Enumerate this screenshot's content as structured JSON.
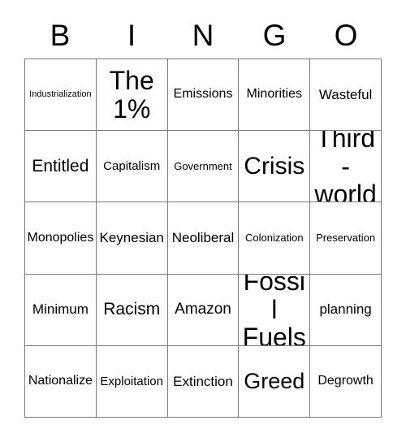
{
  "card": {
    "header_letters": [
      "B",
      "I",
      "N",
      "G",
      "O"
    ],
    "grid_size": 5,
    "colors": {
      "background": "#ffffff",
      "text": "#000000",
      "border": "#7a7a7a"
    },
    "rows": [
      [
        {
          "label": "Industrialization",
          "size": "fs-xxs"
        },
        {
          "label": "The 1%",
          "size": "fs-h2"
        },
        {
          "label": "Emissions",
          "size": "fs-m"
        },
        {
          "label": "Minorities",
          "size": "fs-m"
        },
        {
          "label": "Wasteful",
          "size": "fs-ml"
        }
      ],
      [
        {
          "label": "Entitled",
          "size": "fs-xl"
        },
        {
          "label": "Capitalism",
          "size": "fs-s"
        },
        {
          "label": "Government",
          "size": "fs-xs"
        },
        {
          "label": "Crisis",
          "size": "fs-h1"
        },
        {
          "label": "Third-world",
          "size": "fs-h2"
        }
      ],
      [
        {
          "label": "Monopolies",
          "size": "fs-m"
        },
        {
          "label": "Keynesian",
          "size": "fs-ml"
        },
        {
          "label": "Neoliberal",
          "size": "fs-ml"
        },
        {
          "label": "Colonization",
          "size": "fs-xs"
        },
        {
          "label": "Preservation",
          "size": "fs-xs"
        }
      ],
      [
        {
          "label": "Minimum",
          "size": "fs-ml"
        },
        {
          "label": "Racism",
          "size": "fs-xl"
        },
        {
          "label": "Amazon",
          "size": "fs-l"
        },
        {
          "label": "Fossil Fuels",
          "size": "fs-h2"
        },
        {
          "label": "planning",
          "size": "fs-ml"
        }
      ],
      [
        {
          "label": "Nationalize",
          "size": "fs-m"
        },
        {
          "label": "Exploitation",
          "size": "fs-s"
        },
        {
          "label": "Extinction",
          "size": "fs-ml"
        },
        {
          "label": "Greed",
          "size": "fs-xxl"
        },
        {
          "label": "Degrowth",
          "size": "fs-m"
        }
      ]
    ]
  }
}
